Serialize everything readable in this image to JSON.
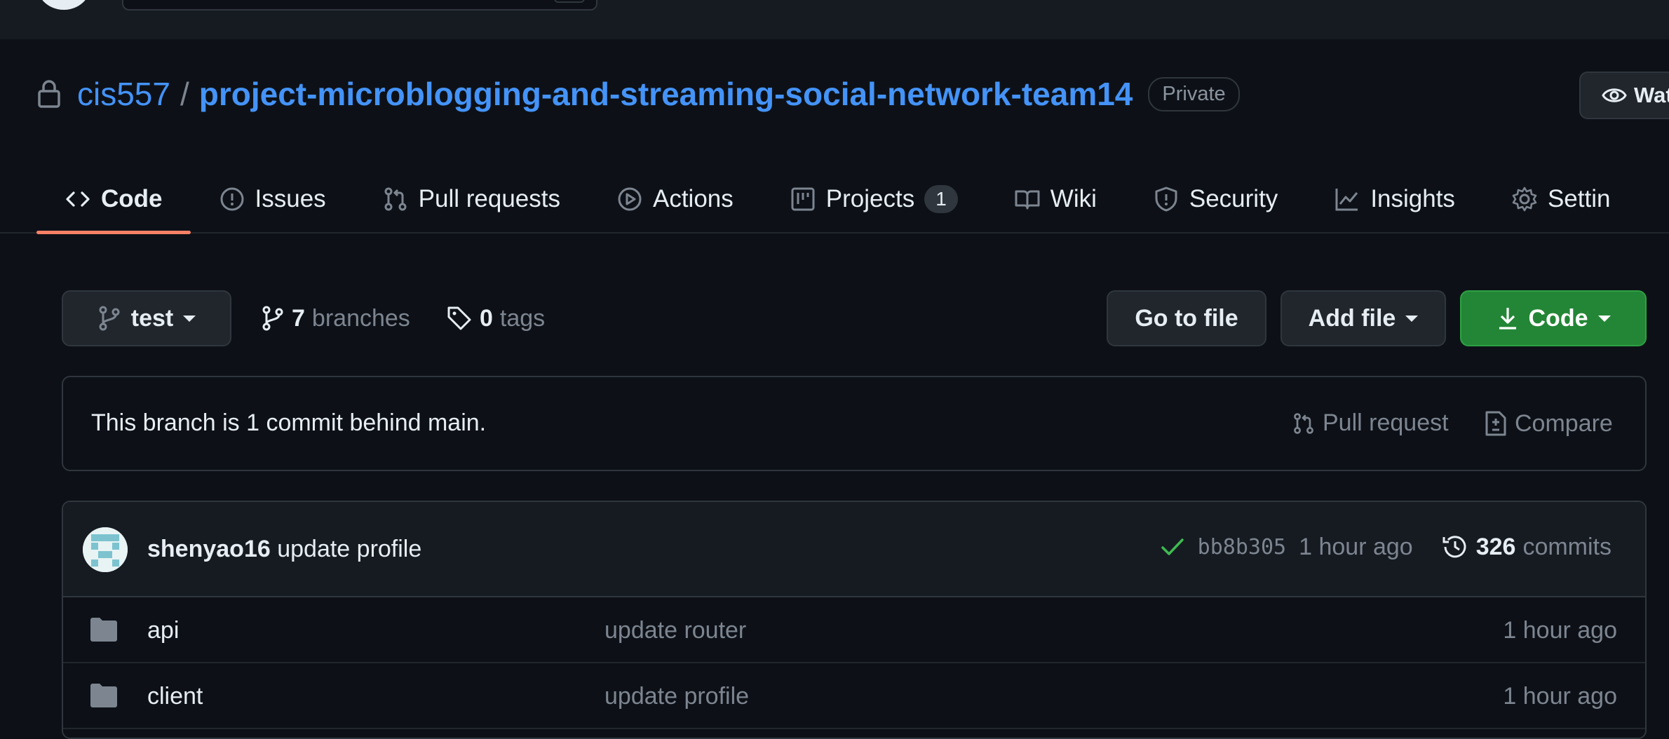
{
  "repo": {
    "owner": "cis557",
    "separator": "/",
    "name": "project-microblogging-and-streaming-social-network-team14",
    "visibility": "Private",
    "watch_label": "Wat"
  },
  "tabs": [
    {
      "label": "Code",
      "icon": "code-icon",
      "selected": true
    },
    {
      "label": "Issues",
      "icon": "issue-icon"
    },
    {
      "label": "Pull requests",
      "icon": "pull-request-icon"
    },
    {
      "label": "Actions",
      "icon": "play-icon"
    },
    {
      "label": "Projects",
      "icon": "project-icon",
      "counter": "1"
    },
    {
      "label": "Wiki",
      "icon": "book-icon"
    },
    {
      "label": "Security",
      "icon": "shield-icon"
    },
    {
      "label": "Insights",
      "icon": "graph-icon"
    },
    {
      "label": "Settin",
      "icon": "gear-icon"
    }
  ],
  "branch_bar": {
    "branch": "test",
    "branches_count": "7",
    "branches_label": "branches",
    "tags_count": "0",
    "tags_label": "tags",
    "go_to_file": "Go to file",
    "add_file": "Add file",
    "code": "Code"
  },
  "notice": {
    "text": "This branch is 1 commit behind main.",
    "pull_request": "Pull request",
    "compare": "Compare"
  },
  "latest_commit": {
    "author": "shenyao16",
    "message": "update profile",
    "sha": "bb8b305",
    "age": "1 hour ago",
    "commits_count": "326",
    "commits_label": "commits"
  },
  "files": [
    {
      "name": "api",
      "message": "update router",
      "age": "1 hour ago"
    },
    {
      "name": "client",
      "message": "update profile",
      "age": "1 hour ago"
    }
  ],
  "colors": {
    "background": "#0d1117",
    "link": "#4493f8",
    "primary_button": "#238636",
    "tab_underline": "#f78166",
    "success": "#3fb950"
  }
}
